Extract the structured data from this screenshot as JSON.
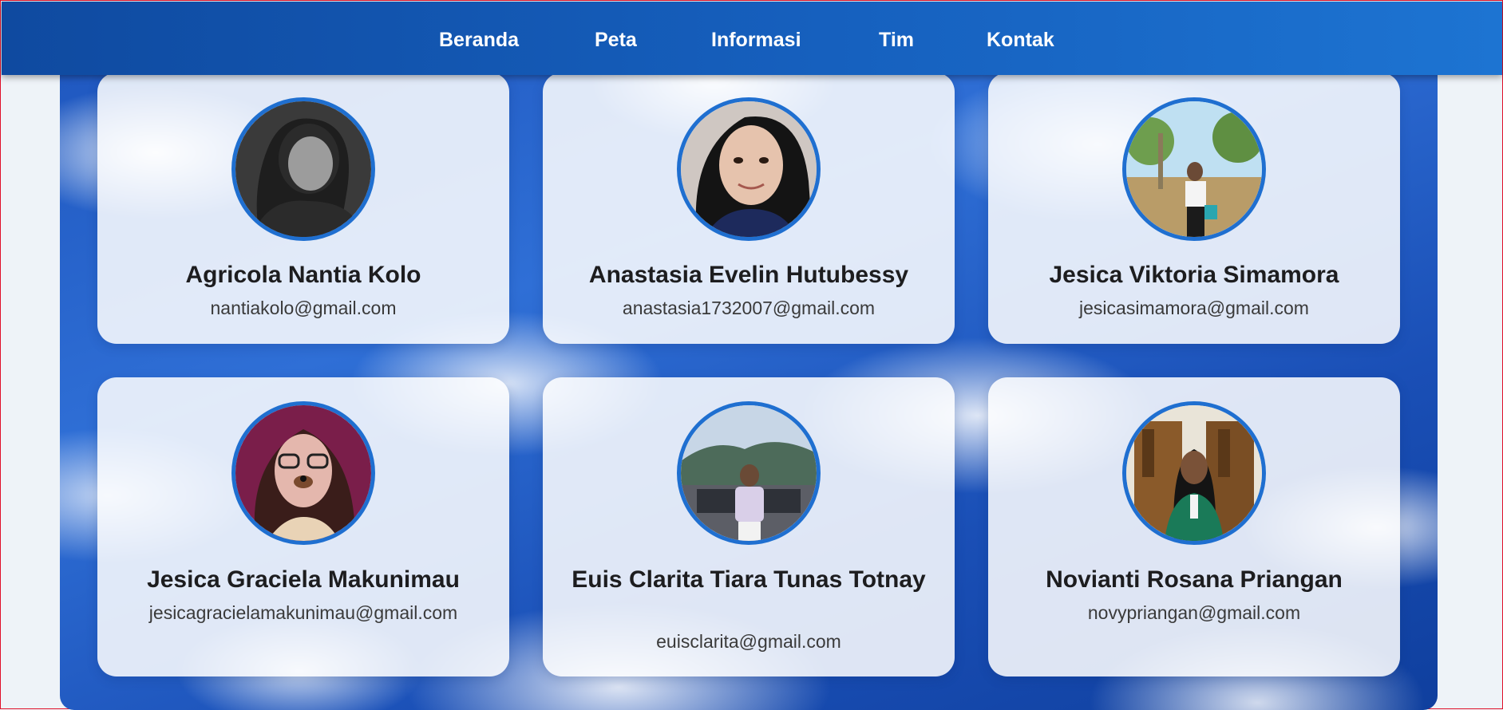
{
  "nav": {
    "items": [
      {
        "label": "Beranda"
      },
      {
        "label": "Peta"
      },
      {
        "label": "Informasi"
      },
      {
        "label": "Tim"
      },
      {
        "label": "Kontak"
      }
    ]
  },
  "team": [
    {
      "name": "Agricola Nantia Kolo",
      "email": "nantiakolo@gmail.com"
    },
    {
      "name": "Anastasia Evelin Hutubessy",
      "email": "anastasia1732007@gmail.com"
    },
    {
      "name": "Jesica Viktoria Simamora",
      "email": "jesicasimamora@gmail.com"
    },
    {
      "name": "Jesica Graciela Makunimau",
      "email": "jesicagracielamakunimau@gmail.com"
    },
    {
      "name": "Euis Clarita Tiara Tunas Totnay",
      "email": "euisclarita@gmail.com"
    },
    {
      "name": "Novianti Rosana Priangan",
      "email": "novypriangan@gmail.com"
    }
  ],
  "colors": {
    "nav_start": "#0f4aa0",
    "nav_end": "#1d74d2",
    "avatar_border": "#1f6fd0",
    "card_bg": "#ffffff"
  }
}
